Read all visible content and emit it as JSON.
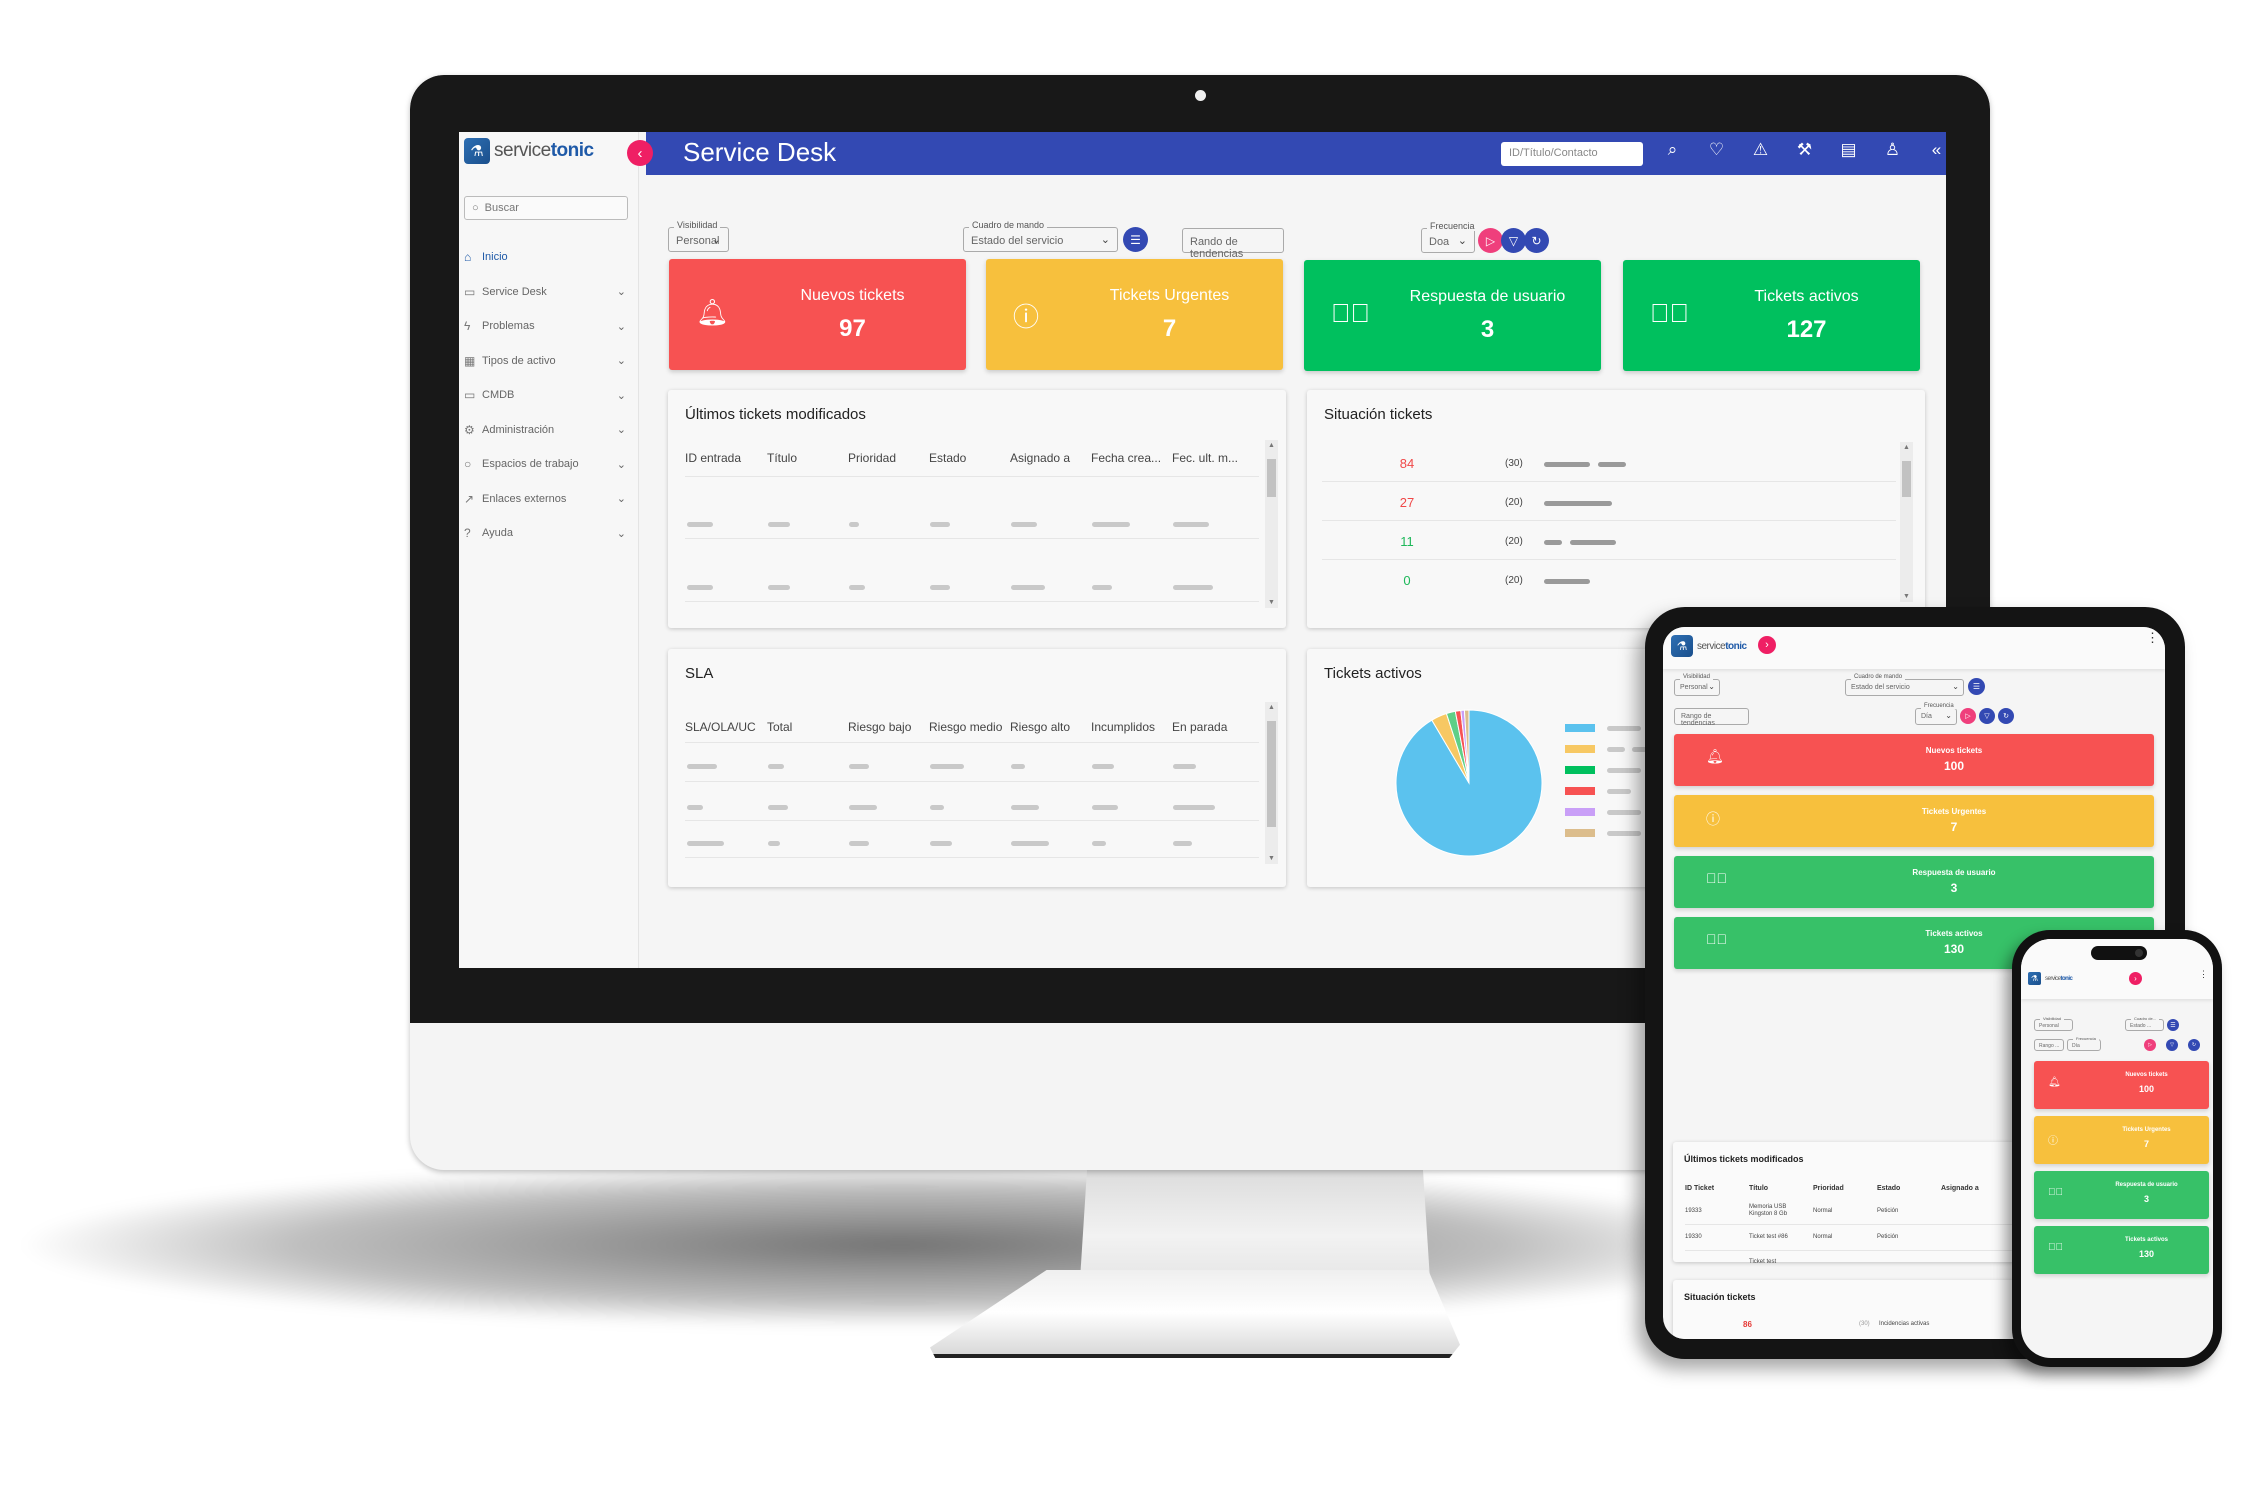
{
  "app": {
    "brand_prefix": "service",
    "brand_suffix": "tonic",
    "title": "Service Desk",
    "header_search_placeholder": "ID/Título/Contacto",
    "header_icons": [
      "search-icon",
      "heart-icon",
      "warning-icon",
      "wrench-icon",
      "briefcase-icon",
      "user-icon",
      "double-chevron-left-icon"
    ]
  },
  "sidebar": {
    "search_placeholder": "Buscar",
    "items": [
      {
        "label": "Inicio",
        "icon": "home-icon",
        "active": true
      },
      {
        "label": "Service Desk",
        "icon": "ticket-icon"
      },
      {
        "label": "Problemas",
        "icon": "bolt-icon"
      },
      {
        "label": "Tipos de activo",
        "icon": "grid-icon"
      },
      {
        "label": "CMDB",
        "icon": "monitor-icon"
      },
      {
        "label": "Administración",
        "icon": "gear-icon"
      },
      {
        "label": "Espacios de trabajo",
        "icon": "circle-icon"
      },
      {
        "label": "Enlaces externos",
        "icon": "external-link-icon"
      },
      {
        "label": "Ayuda",
        "icon": "help-icon"
      }
    ]
  },
  "filters": {
    "visibilidad_label": "Visibilidad",
    "visibilidad_value": "Personal",
    "cuadro_label": "Cuadro de mando",
    "cuadro_value": "Estado del servicio",
    "rango_placeholder": "Rando de tendencias",
    "frecuencia_label": "Frecuencia",
    "frecuencia_value": "Doa"
  },
  "colors": {
    "primary": "#3349b3",
    "accent": "#ef1f64",
    "red": "#f75252",
    "yellow": "#f7c03d",
    "green": "#00c05e",
    "green_mobile": "#37c168"
  },
  "kpis": [
    {
      "label": "Nuevos tickets",
      "value": "97",
      "icon": "bell-icon",
      "color": "red"
    },
    {
      "label": "Tickets Urgentes",
      "value": "7",
      "icon": "alert-circle-icon",
      "color": "yellow"
    },
    {
      "label": "Respuesta de usuario",
      "value": "3",
      "icon": "check-circle-icon",
      "color": "green"
    },
    {
      "label": "Tickets activos",
      "value": "127",
      "icon": "check-circle-icon",
      "color": "green"
    }
  ],
  "ultimos": {
    "title": "Últimos tickets modificados",
    "columns": [
      "ID entrada",
      "Título",
      "Prioridad",
      "Estado",
      "Asignado a",
      "Fecha crea...",
      "Fec. ult. m..."
    ]
  },
  "situacion": {
    "title": "Situación tickets",
    "rows": [
      {
        "value": "84",
        "count": "(30)",
        "status": "red"
      },
      {
        "value": "27",
        "count": "(20)",
        "status": "red"
      },
      {
        "value": "11",
        "count": "(20)",
        "status": "green"
      },
      {
        "value": "0",
        "count": "(20)",
        "status": "green"
      }
    ]
  },
  "sla": {
    "title": "SLA",
    "columns": [
      "SLA/OLA/UC",
      "Total",
      "Riesgo bajo",
      "Riesgo medio",
      "Riesgo alto",
      "Incumplidos",
      "En parada"
    ]
  },
  "activos": {
    "title": "Tickets activos",
    "slices": [
      {
        "color": "#5bc2ee",
        "share": 0.915
      },
      {
        "color": "#f7c863",
        "share": 0.035
      },
      {
        "color": "#5fcf87",
        "share": 0.02
      },
      {
        "color": "#f75252",
        "share": 0.012
      },
      {
        "color": "#c99ff7",
        "share": 0.008
      },
      {
        "color": "#dcbd8c",
        "share": 0.01
      }
    ],
    "legend_colors": [
      "#5bc2ee",
      "#f7c863",
      "#00c05e",
      "#f75252",
      "#c99ff7",
      "#dcbd8c"
    ]
  },
  "tablet": {
    "visibilidad_label": "Visibilidad",
    "visibilidad_value": "Personal",
    "cuadro_label": "Cuadro de mando",
    "cuadro_value": "Estado del servicio",
    "rango_placeholder": "Rango de tendencias",
    "frecuencia_label": "Frecuencia",
    "frecuencia_value": "Día",
    "kpis": [
      {
        "label": "Nuevos tickets",
        "value": "100"
      },
      {
        "label": "Tickets Urgentes",
        "value": "7"
      },
      {
        "label": "Respuesta de usuario",
        "value": "3"
      },
      {
        "label": "Tickets activos",
        "value": "130"
      }
    ],
    "ultimos_title": "Últimos tickets modificados",
    "columns": [
      "ID Ticket",
      "Título",
      "Prioridad",
      "Estado",
      "Asignado a"
    ],
    "rows": [
      {
        "id": "19333",
        "titulo": "Memoria USB Kingston 8 Gb",
        "prioridad": "Normal",
        "estado": "Petición"
      },
      {
        "id": "19330",
        "titulo": "Ticket test #86",
        "prioridad": "Normal",
        "estado": "Petición"
      },
      {
        "id": "",
        "titulo": "Ticket test",
        "prioridad": "",
        "estado": ""
      }
    ],
    "situacion_title": "Situación tickets",
    "situacion_row": {
      "value": "86",
      "count": "(30)",
      "label": "Incidencias activas"
    }
  },
  "phone": {
    "visibilidad_label": "Visibilidad",
    "visibilidad_value": "Personal",
    "cuadro_label": "Cuadro de...",
    "cuadro_value": "Estado ...",
    "rango_placeholder": "Rango ...",
    "frecuencia_label": "Frecuencia",
    "frecuencia_value": "Día",
    "kpis": [
      {
        "label": "Nuevos tickets",
        "value": "100"
      },
      {
        "label": "Tickets Urgentes",
        "value": "7"
      },
      {
        "label": "Respuesta de usuario",
        "value": "3"
      },
      {
        "label": "Tickets activos",
        "value": "130"
      }
    ]
  }
}
